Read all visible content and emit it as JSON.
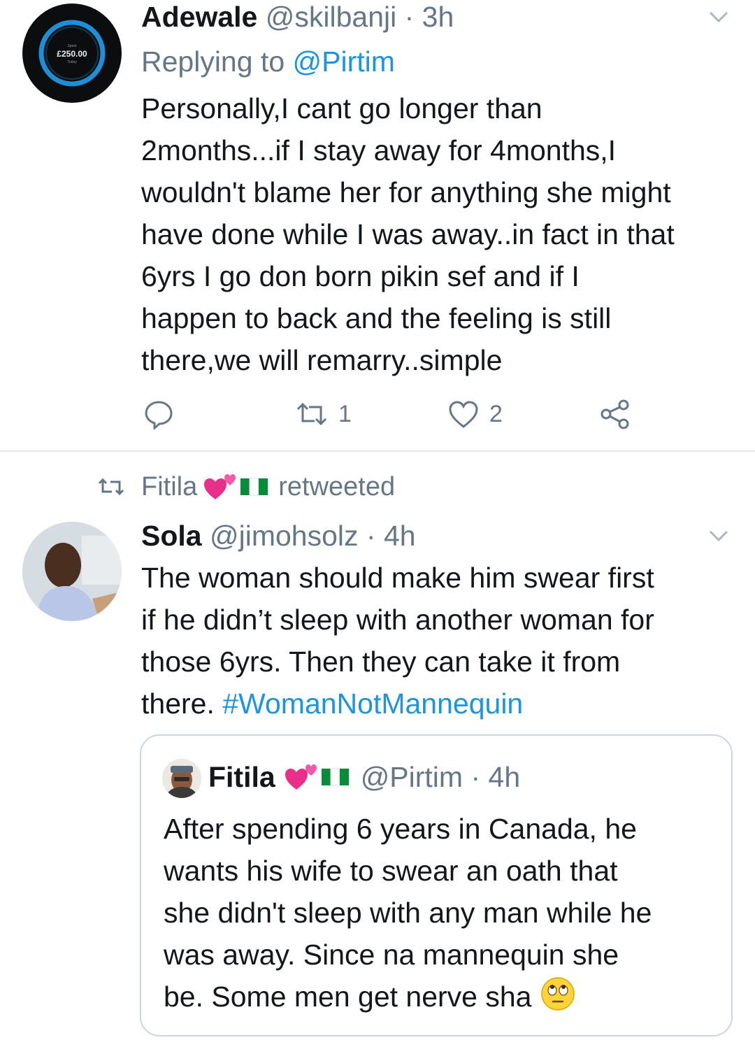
{
  "tweet1": {
    "avatar_text_top": "Spent",
    "avatar_amount": "£250.00",
    "avatar_text_bottom": "Today",
    "name": "Adewale",
    "handle": "@skilbanji",
    "sep": " · ",
    "time": "3h",
    "replying_prefix": "Replying to ",
    "replying_handle": "@Pirtim",
    "text": "Personally,I cant go longer than\n2months...if I stay away for 4months,I\nwouldn't blame her for anything she might\nhave done while I was away..in fact in that\n6yrs I go don born pikin sef and if I\nhappen to back and the feeling is still\nthere,we will remarry..simple",
    "actions": {
      "retweets": "1",
      "likes": "2"
    }
  },
  "retweet_banner": {
    "name": "Fitila",
    "label": "retweeted"
  },
  "tweet2": {
    "name": "Sola",
    "handle": "@jimohsolz",
    "sep": " · ",
    "time": "4h",
    "text": "The woman should make him swear first\nif he didn’t sleep with another woman for\nthose 6yrs. Then they can take it from\nthere. ",
    "hashtag": "#WomanNotMannequin",
    "quote": {
      "name": "Fitila",
      "handle": "@Pirtim",
      "sep": " · ",
      "time": "4h",
      "text": "After spending 6 years in Canada, he\nwants his wife to swear an oath that\nshe didn't sleep with any man while he\nwas away. Since na mannequin she\nbe.  Some men get nerve sha"
    }
  },
  "colors": {
    "link": "#1b95e0",
    "meta": "#657786",
    "text": "#14171a",
    "divider": "#e1e8ed"
  },
  "icons": [
    "chevron-down-icon",
    "reply-icon",
    "retweet-icon",
    "like-icon",
    "share-icon",
    "two-hearts-emoji",
    "nigeria-flag-emoji",
    "eye-roll-emoji"
  ]
}
